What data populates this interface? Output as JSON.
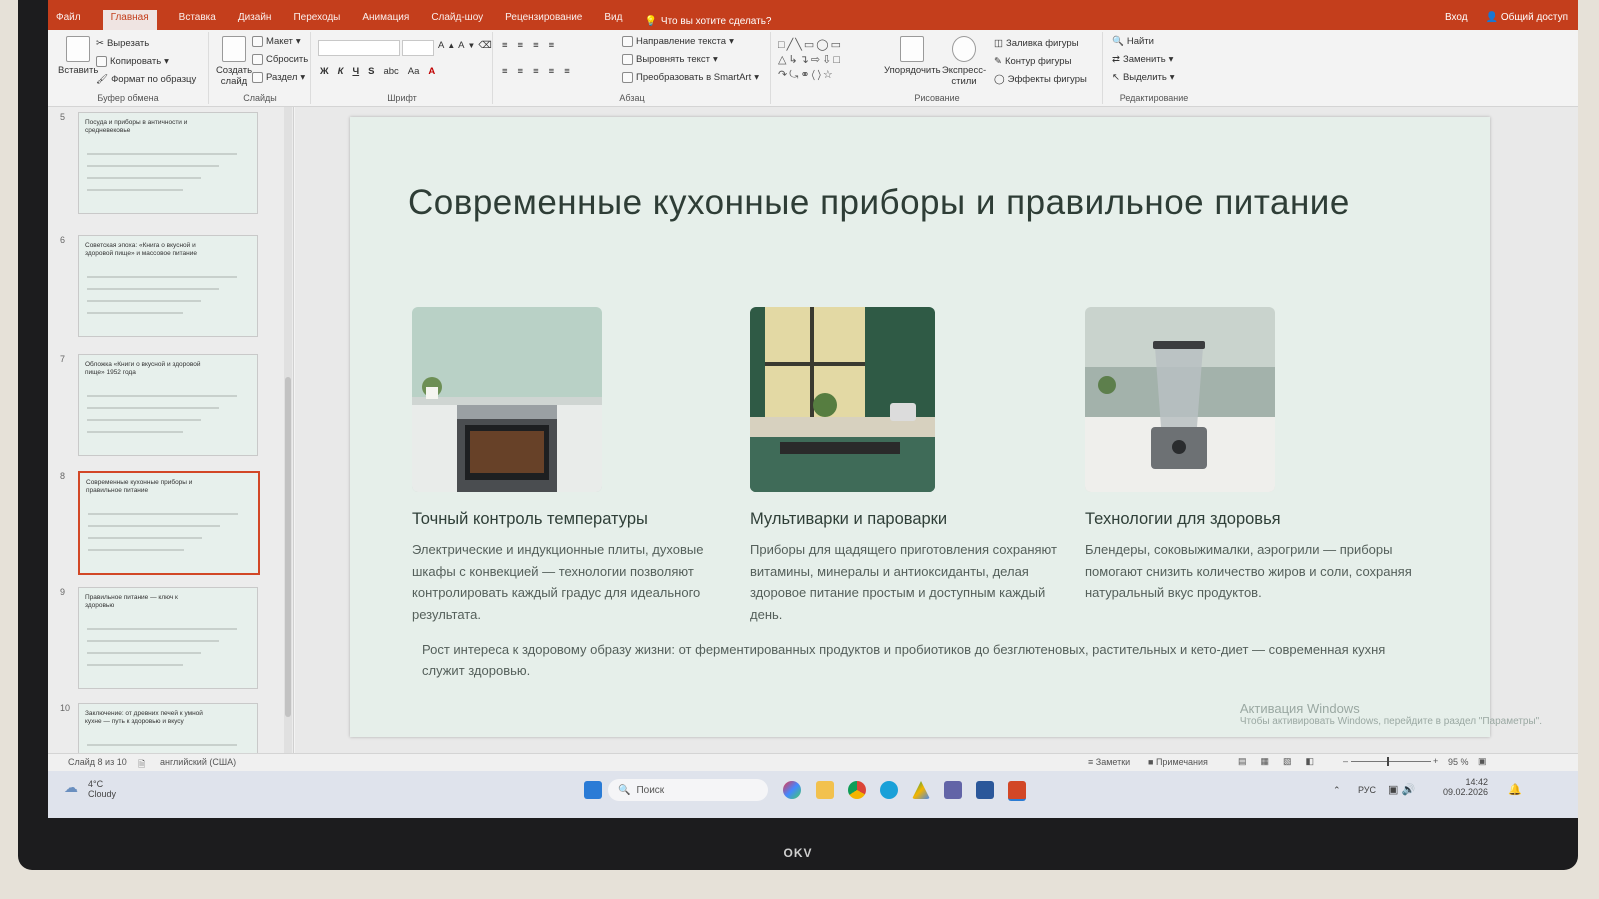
{
  "window": {
    "tabs": [
      "Файл",
      "Главная",
      "Вставка",
      "Дизайн",
      "Переходы",
      "Анимация",
      "Слайд-шоу",
      "Рецензирование",
      "Вид"
    ],
    "active_tab": "Главная",
    "tell_me": "Что вы хотите сделать?",
    "signin": "Вход",
    "share": "Общий доступ"
  },
  "ribbon": {
    "clipboard": {
      "paste": "Вставить",
      "cut": "Вырезать",
      "copy": "Копировать",
      "format_painter": "Формат по образцу",
      "label": "Буфер обмена"
    },
    "slides": {
      "new_slide": "Создать слайд",
      "layout": "Макет",
      "reset": "Сбросить",
      "section": "Раздел",
      "label": "Слайды"
    },
    "font": {
      "label": "Шрифт",
      "bold": "Ж",
      "italic": "К",
      "underline": "Ч",
      "strike": "S",
      "spacing": "abc",
      "case": "Aa",
      "color": "A"
    },
    "paragraph": {
      "text_direction": "Направление текста",
      "align_text": "Выровнять текст",
      "smartart": "Преобразовать в SmartArt",
      "label": "Абзац"
    },
    "drawing": {
      "arrange": "Упорядочить",
      "quick_styles": "Экспресс-стили",
      "shape_fill": "Заливка фигуры",
      "shape_outline": "Контур фигуры",
      "shape_effects": "Эффекты фигуры",
      "label": "Рисование"
    },
    "editing": {
      "find": "Найти",
      "replace": "Заменить",
      "select": "Выделить",
      "label": "Редактирование"
    }
  },
  "thumbnails": [
    {
      "num": "5",
      "title": "Посуда и приборы в античности и средневековье"
    },
    {
      "num": "6",
      "title": "Советская эпоха: «Книга о вкусной и здоровой пище» и массовое питание"
    },
    {
      "num": "7",
      "title": "Обложка «Книги о вкусной и здоровой пище» 1952 года"
    },
    {
      "num": "8",
      "title": "Современные кухонные приборы и правильное питание",
      "selected": true
    },
    {
      "num": "9",
      "title": "Правильное питание — ключ к здоровью"
    },
    {
      "num": "10",
      "title": "Заключение: от древних печей к умной кухне — путь к здоровью и вкусу"
    }
  ],
  "slide": {
    "title": "Современные кухонные приборы и правильное питание",
    "cards": [
      {
        "title": "Точный контроль температуры",
        "text": "Электрические и индукционные плиты, духовые шкафы с конвекцией — технологии позволяют контролировать каждый градус для идеального результата."
      },
      {
        "title": "Мультиварки и пароварки",
        "text": "Приборы для щадящего приготовления сохраняют витамины, минералы и антиоксиданты, делая здоровое питание простым и доступным каждый день."
      },
      {
        "title": "Технологии для здоровья",
        "text": "Блендеры, соковыжималки, аэрогрили — приборы помогают снизить количество жиров и соли, сохраняя натуральный вкус продуктов."
      }
    ],
    "bottom": "Рост интереса к здоровому образу жизни: от ферментированных продуктов и пробиотиков до безглютеновых, растительных и кето-диет — современная кухня служит здоровью."
  },
  "watermark": {
    "line1": "Активация Windows",
    "line2": "Чтобы активировать Windows, перейдите в раздел \"Параметры\"."
  },
  "status": {
    "slide": "Слайд 8 из 10",
    "language": "английский (США)",
    "notes": "Заметки",
    "comments": "Примечания",
    "zoom": "95 %"
  },
  "taskbar": {
    "weather_temp": "4°C",
    "weather_desc": "Cloudy",
    "search": "Поиск",
    "lang": "РУС",
    "time": "14:42",
    "date": "09.02.2026"
  },
  "monitor_brand": "OKV",
  "colors": {
    "accent": "#c43e1c",
    "slide_bg": "#e6efea",
    "selection": "#d24726"
  }
}
